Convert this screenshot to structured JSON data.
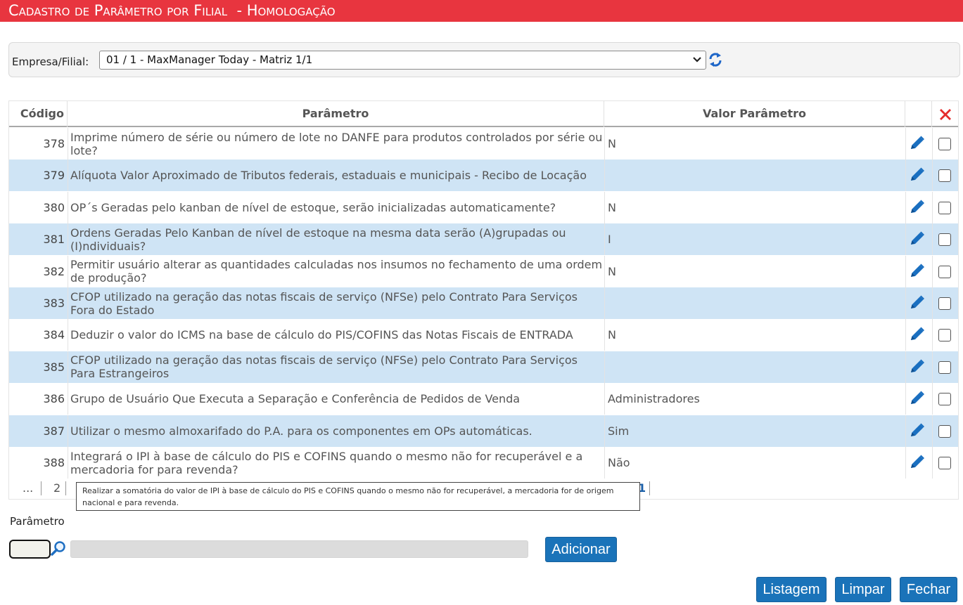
{
  "header": {
    "title": "Cadastro de Parâmetro por Filial  - Homologação",
    "bg_color": "#e8353f"
  },
  "filter": {
    "label": "Empresa/Filial:",
    "selected": "01 / 1 - MaxManager Today - Matriz 1/1",
    "refresh_icon": "refresh-icon"
  },
  "grid": {
    "columns": {
      "code": "Código",
      "param": "Parâmetro",
      "value": "Valor Parâmetro",
      "delete_icon": "delete-x-icon"
    },
    "rows": [
      {
        "code": "378",
        "param": "Imprime número de série ou número de lote no DANFE para produtos controlados por série ou lote?",
        "value": "N"
      },
      {
        "code": "379",
        "param": "Alíquota Valor Aproximado de Tributos federais, estaduais e municipais - Recibo de Locação",
        "value": ""
      },
      {
        "code": "380",
        "param": "OP´s Geradas pelo kanban de nível de estoque, serão inicializadas automaticamente?",
        "value": "N"
      },
      {
        "code": "381",
        "param": "Ordens Geradas Pelo Kanban de nível de estoque na mesma data serão (A)grupadas ou (I)ndividuais?",
        "value": "I"
      },
      {
        "code": "382",
        "param": "Permitir usuário alterar as quantidades calculadas nos insumos no fechamento de uma ordem de produção?",
        "value": "N"
      },
      {
        "code": "383",
        "param": "CFOP utilizado na geração das notas fiscais de serviço (NFSe) pelo Contrato Para Serviços Fora do Estado",
        "value": ""
      },
      {
        "code": "384",
        "param": "Deduzir o valor do ICMS na base de cálculo do PIS/COFINS das Notas Fiscais de ENTRADA",
        "value": "N"
      },
      {
        "code": "385",
        "param": "CFOP utilizado na geração das notas fiscais de serviço (NFSe) pelo Contrato Para Serviços Para Estrangeiros",
        "value": ""
      },
      {
        "code": "386",
        "param": "Grupo de Usuário Que Executa a Separação e Conferência de Pedidos de Venda",
        "value": "Administradores"
      },
      {
        "code": "387",
        "param": "Utilizar o mesmo almoxarifado do P.A. para os componentes em OPs automáticas.",
        "value": "Sim"
      },
      {
        "code": "388",
        "param": "Integrará o IPI à base de cálculo do PIS e COFINS quando o mesmo não for recuperável e a mercadoria for para revenda?",
        "value": "Não"
      }
    ],
    "row_alt_color": "#cfe4f5"
  },
  "pager": {
    "ellipsis": "...",
    "page_2": "2",
    "page_last": "1"
  },
  "tooltip": {
    "text": "Realizar a somatória do valor de IPI à base de cálculo do PIS e COFINS quando o mesmo não for recuperável, a mercadoria for de origem nacional e para revenda."
  },
  "form": {
    "param_label": "Parâmetro",
    "code_value": "",
    "desc_value": "",
    "add_button": "Adicionar"
  },
  "footer": {
    "list_button": "Listagem",
    "clear_button": "Limpar",
    "close_button": "Fechar",
    "button_color": "#1a73b9"
  }
}
